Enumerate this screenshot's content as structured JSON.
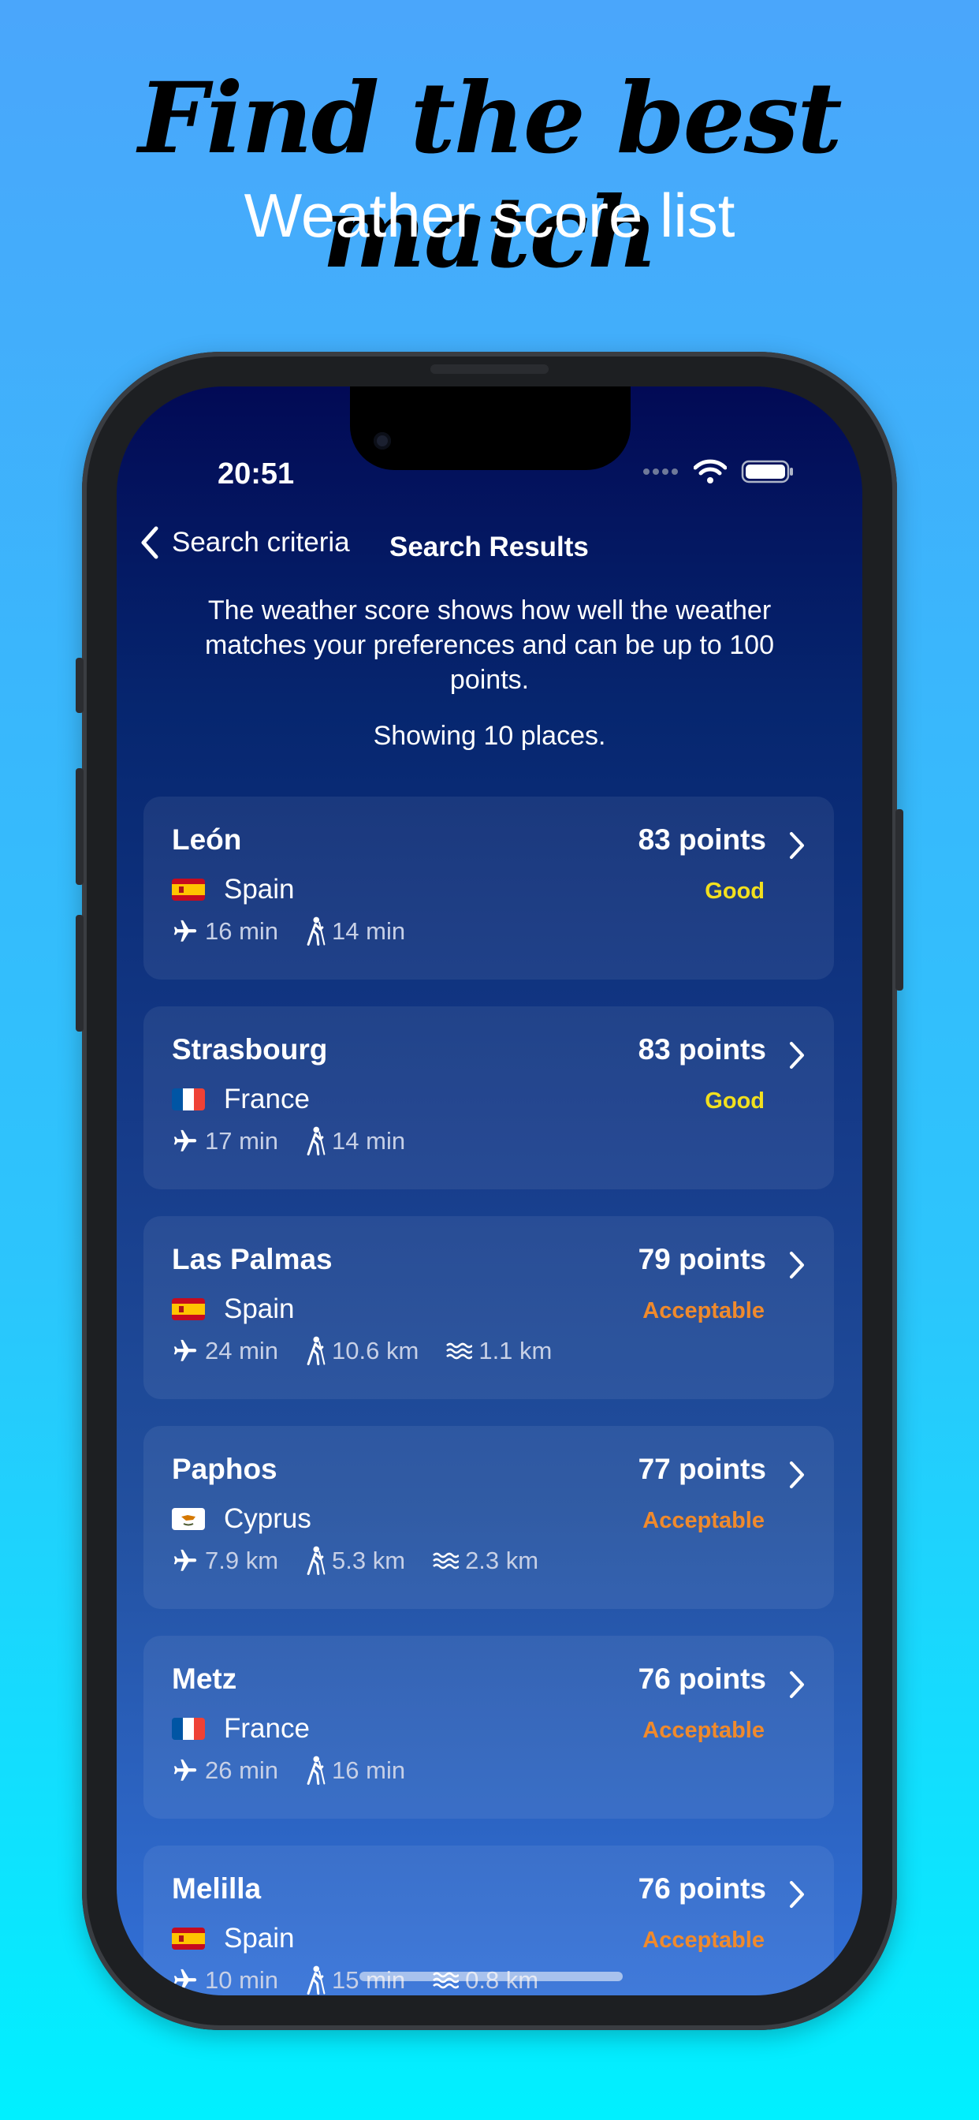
{
  "headline": "Find the best match",
  "subheadline": "Weather score list",
  "status_bar": {
    "time": "20:51"
  },
  "nav": {
    "back_label": "Search criteria",
    "title": "Search Results"
  },
  "intro_text": "The weather score shows how well the weather matches your preferences and can be up to 100 points.",
  "result_count": "Showing 10 places.",
  "colors": {
    "good": "#f2e01e",
    "acceptable": "#f08a2c"
  },
  "places": [
    {
      "name": "León",
      "points": "83 points",
      "country": "Spain",
      "flag": "spain-flag-icon",
      "rating": "Good",
      "flight": "16 min",
      "hike": "14 min",
      "sea": ""
    },
    {
      "name": "Strasbourg",
      "points": "83 points",
      "country": "France",
      "flag": "france-flag-icon",
      "rating": "Good",
      "flight": "17 min",
      "hike": "14 min",
      "sea": ""
    },
    {
      "name": "Las Palmas",
      "points": "79 points",
      "country": "Spain",
      "flag": "spain-flag-icon",
      "rating": "Acceptable",
      "flight": "24 min",
      "hike": "10.6 km",
      "sea": "1.1 km"
    },
    {
      "name": "Paphos",
      "points": "77 points",
      "country": "Cyprus",
      "flag": "cyprus-flag-icon",
      "rating": "Acceptable",
      "flight": "7.9 km",
      "hike": "5.3 km",
      "sea": "2.3 km"
    },
    {
      "name": "Metz",
      "points": "76 points",
      "country": "France",
      "flag": "france-flag-icon",
      "rating": "Acceptable",
      "flight": "26 min",
      "hike": "16 min",
      "sea": ""
    },
    {
      "name": "Melilla",
      "points": "76 points",
      "country": "Spain",
      "flag": "spain-flag-icon",
      "rating": "Acceptable",
      "flight": "10 min",
      "hike": "15 min",
      "sea": "0.8 km"
    }
  ]
}
